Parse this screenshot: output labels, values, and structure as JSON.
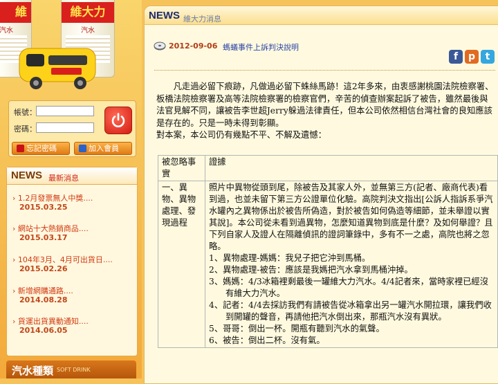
{
  "banner": {
    "can_text_left": "維",
    "can_text_right": "維大力",
    "can_sub": "汽水"
  },
  "login": {
    "account_label": "帳號：",
    "password_label": "密碼：",
    "forgot_label": "忘記密碼",
    "join_label": "加入會員"
  },
  "news_sidebar": {
    "title": "NEWS",
    "subtitle": "最新消息",
    "items": [
      {
        "title": "› 1.2月發票無人中獎....",
        "date": "2015.03.25"
      },
      {
        "title": "› 網站十大熱銷商品....",
        "date": "2015.03.17"
      },
      {
        "title": "› 104年3月、4月可出貨日....",
        "date": "2015.02.26"
      },
      {
        "title": "› 新增網購通路....",
        "date": "2014.08.28"
      },
      {
        "title": "› 貨運出貨異動通知....",
        "date": "2014.06.05"
      }
    ]
  },
  "soda": {
    "title": "汽水種類",
    "subtitle": "SOFT DRINK"
  },
  "main": {
    "header_title": "NEWS",
    "header_sub": "維大力消息",
    "date": "2012-09-06",
    "article_title": "螞蟻事件上訴判決說明",
    "social": {
      "facebook": "f",
      "plurk": "p",
      "twitter": "t"
    },
    "paragraph1": "　　凡走過必留下痕跡，凡做過必留下蛛絲馬跡！這2年多來，由衷感謝桃園法院檢察署、板橋法院檢察署及高等法院檢察署的檢察官們，辛苦的偵查辦案起訴了被告，雖然最後與法官見解不同，讓被告李世超Jerry躲過法律責任，但本公司依然相信台灣社會的良知應該是存在的。只是一時未得到彰顯。",
    "paragraph2": "對本案，本公司仍有幾點不平、不解及遺憾：",
    "table": {
      "col1_header": "被忽略事實",
      "col2_header": "證據",
      "row1_col1": "一、異物、異物處理、發現過程",
      "row1_intro": "照片中異物從頭到尾，除被告及其家人外，並無第三方(記者、廠商代表)看到過，也並未留下第三方公證單位化驗。高院判決文指出[公訴人指訴系爭汽水罐內之異物係出於被告所偽造，對於被告如何偽造等細節，並未舉證以實其說]。本公司從未看到過異物，怎麼知道異物到底是什麼？及如何舉證？且下列自家人及證人在隔離偵訊的證詞筆錄中，多有不一之處，高院也將之忽略。",
      "items": [
        "1、異物處理-媽媽：我兒子把它沖到馬桶。",
        "2、異物處理-被告：應該是我媽把汽水拿到馬桶沖掉。",
        "3、媽媽：4/3冰箱裡剩最後一罐維大力汽水。4/4記者來，當時家裡已經沒有維大力汽水。",
        "4、記者：4/4去採訪我們有請被告從冰箱拿出另一罐汽水開拉環，讓我們收到開罐的聲音，再請他把汽水倒出來，那瓶汽水沒有異狀。",
        "5、哥哥：倒出一杯。開瓶有聽到汽水的氣聲。",
        "6、被告：倒出二杯。沒有氣。"
      ]
    }
  }
}
